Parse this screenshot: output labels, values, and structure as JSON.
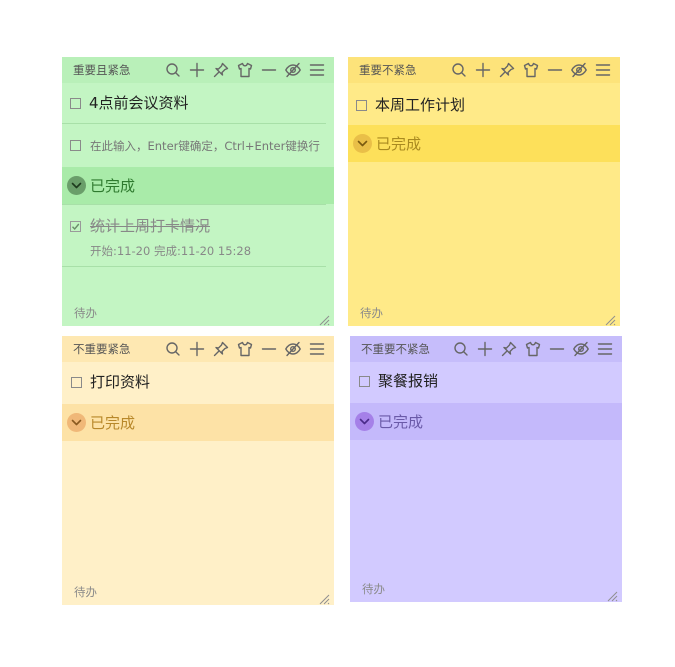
{
  "notes": {
    "q1": {
      "title": "重要且紧急",
      "tasks": [
        "4点前会议资料"
      ],
      "input_placeholder": "在此输入，Enter键确定，Ctrl+Enter键换行",
      "done_label": "已完成",
      "done_items": [
        {
          "text": "统计上周打卡情况",
          "meta": "开始:11-20    完成:11-20 15:28"
        }
      ],
      "footer": "待办"
    },
    "q2": {
      "title": "重要不紧急",
      "tasks": [
        "本周工作计划"
      ],
      "done_label": "已完成",
      "footer": "待办"
    },
    "q3": {
      "title": "不重要紧急",
      "tasks": [
        "打印资料"
      ],
      "done_label": "已完成",
      "footer": "待办"
    },
    "q4": {
      "title": "不重要不紧急",
      "tasks": [
        "聚餐报销"
      ],
      "done_label": "已完成",
      "footer": "待办"
    }
  },
  "icons": [
    "search-icon",
    "add-icon",
    "pin-icon",
    "skin-icon",
    "minimize-icon",
    "hide-icon",
    "menu-icon"
  ],
  "colors": {
    "q1_bg": "#c3f5c3",
    "q2_bg": "#ffea88",
    "q3_bg": "#fff0c8",
    "q4_bg": "#d2caff"
  }
}
